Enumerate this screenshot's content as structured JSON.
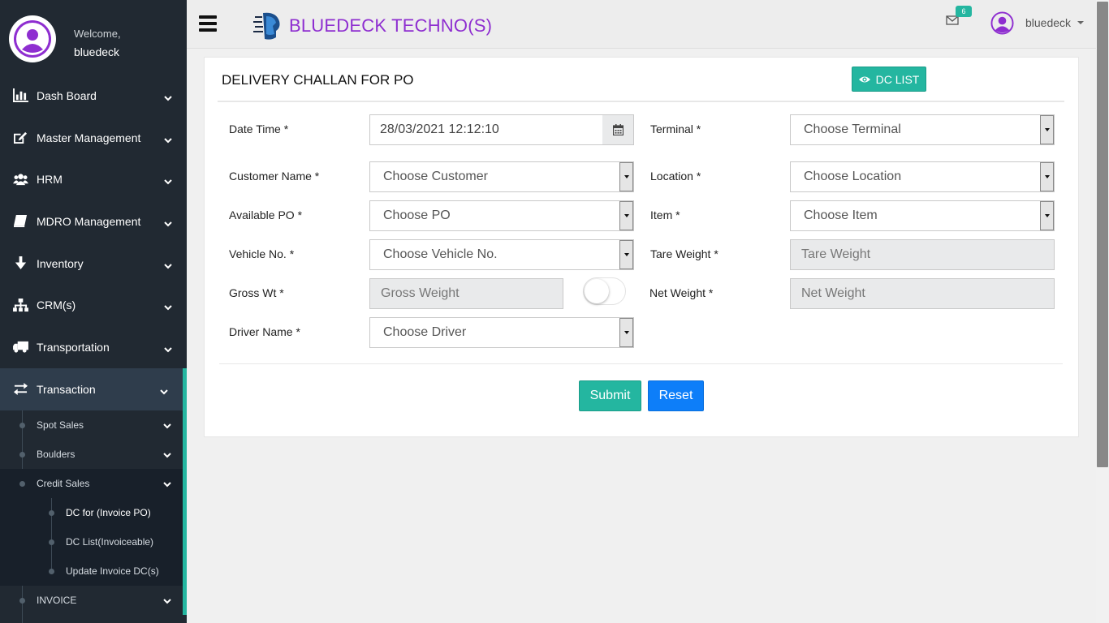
{
  "sidebar": {
    "welcome": "Welcome,",
    "username": "bluedeck",
    "items": [
      {
        "label": "Dash Board",
        "icon": "bar-chart-icon"
      },
      {
        "label": "Master Management",
        "icon": "edit-icon"
      },
      {
        "label": "HRM",
        "icon": "users-icon"
      },
      {
        "label": "MDRO Management",
        "icon": "book-icon"
      },
      {
        "label": "Inventory",
        "icon": "arrow-down-icon"
      },
      {
        "label": "CRM(s)",
        "icon": "sitemap-icon"
      },
      {
        "label": "Transportation",
        "icon": "truck-icon"
      },
      {
        "label": "Transaction",
        "icon": "exchange-icon"
      }
    ],
    "sub_items": [
      "Spot Sales",
      "Boulders",
      "Credit Sales"
    ],
    "subsub_items": [
      "DC for (Invoice PO)",
      "DC List(Invoiceable)",
      "Update Invoice DC(s)"
    ],
    "last_item": "INVOICE",
    "accent": "#24b6a0"
  },
  "topbar": {
    "brand": "BLUEDECK TECHNO(S)",
    "brand_color": "#8e2ed0",
    "mail_badge": "6",
    "user": "bluedeck"
  },
  "form": {
    "title": "DELIVERY CHALLAN FOR PO",
    "dc_list_label": "DC LIST",
    "labels": {
      "date_time": "Date Time *",
      "terminal": "Terminal *",
      "customer_name": "Customer Name *",
      "location": "Location *",
      "available_po": "Available PO *",
      "item": "Item *",
      "vehicle_no": "Vehicle No. *",
      "tare_weight": "Tare Weight *",
      "gross_wt": "Gross Wt *",
      "net_weight": "Net Weight *",
      "driver_name": "Driver Name *"
    },
    "values": {
      "date_time": "28/03/2021 12:12:10",
      "terminal": "Choose Terminal",
      "customer": "Choose Customer",
      "location": "Choose Location",
      "po": "Choose PO",
      "item": "Choose Item",
      "vehicle": "Choose Vehicle No.",
      "tare_weight": "Tare Weight",
      "gross_weight": "Gross Weight",
      "net_weight": "Net Weight",
      "driver": "Choose Driver"
    },
    "submit_label": "Submit",
    "reset_label": "Reset"
  }
}
